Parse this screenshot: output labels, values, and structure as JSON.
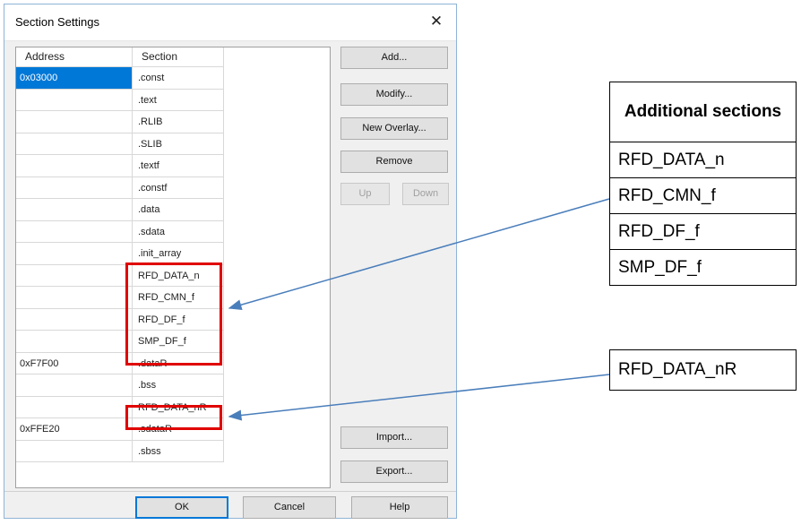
{
  "dialog": {
    "title": "Section Settings",
    "close_glyph": "✕",
    "columns": [
      "Address",
      "Section"
    ],
    "rows": [
      {
        "address": "0x03000",
        "section": ".const",
        "selected": true
      },
      {
        "address": "",
        "section": ".text"
      },
      {
        "address": "",
        "section": ".RLIB"
      },
      {
        "address": "",
        "section": ".SLIB"
      },
      {
        "address": "",
        "section": ".textf"
      },
      {
        "address": "",
        "section": ".constf"
      },
      {
        "address": "",
        "section": ".data"
      },
      {
        "address": "",
        "section": ".sdata"
      },
      {
        "address": "",
        "section": ".init_array"
      },
      {
        "address": "",
        "section": "RFD_DATA_n"
      },
      {
        "address": "",
        "section": "RFD_CMN_f"
      },
      {
        "address": "",
        "section": "RFD_DF_f"
      },
      {
        "address": "",
        "section": "SMP_DF_f"
      },
      {
        "address": "0xF7F00",
        "section": ".dataR"
      },
      {
        "address": "",
        "section": ".bss"
      },
      {
        "address": "",
        "section": "RFD_DATA_nR"
      },
      {
        "address": "0xFFE20",
        "section": ".sdataR"
      },
      {
        "address": "",
        "section": ".sbss"
      }
    ],
    "buttons": {
      "add": "Add...",
      "modify": "Modify...",
      "new_overlay": "New Overlay...",
      "remove": "Remove",
      "up": "Up",
      "down": "Down",
      "import": "Import...",
      "export": "Export...",
      "ok": "OK",
      "cancel": "Cancel",
      "help": "Help"
    }
  },
  "annotation": {
    "table_header": "Additional sections",
    "table_items": [
      "RFD_DATA_n",
      "RFD_CMN_f",
      "RFD_DF_f",
      "SMP_DF_f"
    ],
    "single_box": "RFD_DATA_nR",
    "highlight_color": "#e00000",
    "arrow_color": "#4a7ebb"
  }
}
